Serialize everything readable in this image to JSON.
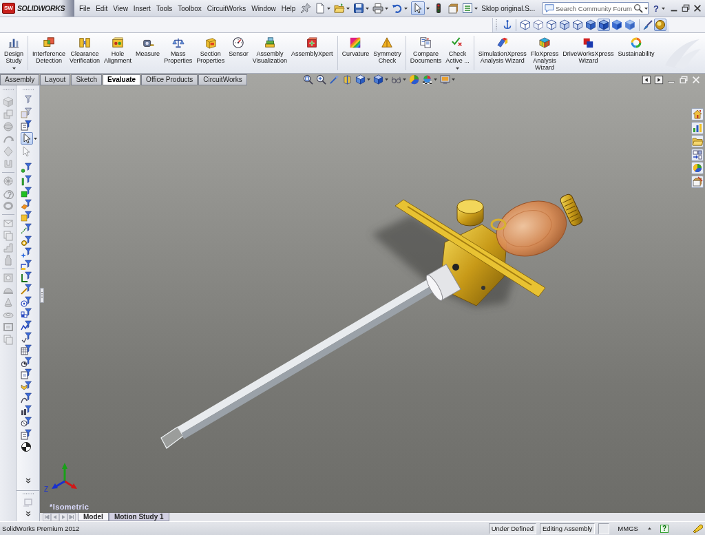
{
  "window": {
    "logo_mark": "SW",
    "logo": "SOLIDWORKS",
    "document_title": "Sklop original.S..."
  },
  "menu": [
    "File",
    "Edit",
    "View",
    "Insert",
    "Tools",
    "Toolbox",
    "CircuitWorks",
    "Window",
    "Help"
  ],
  "standard_toolbar": {
    "select_tool": {
      "selected": true
    }
  },
  "search": {
    "placeholder": "Search Community Forum"
  },
  "help_button": {
    "label": "?"
  },
  "view_toolbar": {
    "display_styles": [
      {
        "selected": false
      },
      {
        "selected": false
      },
      {
        "selected": false
      },
      {
        "selected": false
      },
      {
        "selected": false
      },
      {
        "selected": false
      },
      {
        "selected": true
      },
      {
        "selected": false
      },
      {
        "selected": false
      }
    ],
    "realview": {
      "on": true
    }
  },
  "ribbon": {
    "groups": [
      {
        "buttons": [
          {
            "label": "Design\nStudy",
            "dropdown": true
          }
        ]
      },
      {
        "buttons": [
          {
            "label": "Interference\nDetection",
            "dropdown": false
          },
          {
            "label": "Clearance\nVerification",
            "dropdown": false
          },
          {
            "label": "Hole\nAlignment",
            "dropdown": false
          },
          {
            "label": "Measure",
            "dropdown": false
          },
          {
            "label": "Mass\nProperties",
            "dropdown": false
          },
          {
            "label": "Section\nProperties",
            "dropdown": false
          },
          {
            "label": "Sensor",
            "dropdown": false
          },
          {
            "label": "Assembly\nVisualization",
            "dropdown": false
          },
          {
            "label": "AssemblyXpert",
            "dropdown": false
          }
        ]
      },
      {
        "buttons": [
          {
            "label": "Curvature",
            "dropdown": false
          },
          {
            "label": "Symmetry\nCheck",
            "dropdown": false
          }
        ]
      },
      {
        "buttons": [
          {
            "label": "Compare\nDocuments",
            "dropdown": false
          },
          {
            "label": "Check\nActive ...",
            "dropdown": true
          }
        ]
      },
      {
        "buttons": [
          {
            "label": "SimulationXpress\nAnalysis Wizard",
            "dropdown": false
          },
          {
            "label": "FloXpress\nAnalysis\nWizard",
            "dropdown": false
          },
          {
            "label": "DriveWorksXpress\nWizard",
            "dropdown": false
          },
          {
            "label": "Sustainability",
            "dropdown": false
          }
        ]
      }
    ]
  },
  "tabs": [
    {
      "label": "Assembly",
      "selected": false
    },
    {
      "label": "Layout",
      "selected": false
    },
    {
      "label": "Sketch",
      "selected": false
    },
    {
      "label": "Evaluate",
      "selected": true
    },
    {
      "label": "Office Products",
      "selected": false
    },
    {
      "label": "CircuitWorks",
      "selected": false
    }
  ],
  "feature_toolbar": {
    "disabled": true
  },
  "selection_filter": {
    "select_tool": {
      "selected": true
    }
  },
  "viewport": {
    "view_name": "*Isometric",
    "triad_axis_label": "Z"
  },
  "model_tabs": [
    {
      "label": "Model",
      "selected": true
    },
    {
      "label": "Motion Study 1",
      "selected": false
    }
  ],
  "status_bar": {
    "product": "SolidWorks Premium 2012",
    "fields": [
      "Under Defined",
      "Editing Assembly"
    ],
    "units": "MMGS",
    "help_glyph": "?"
  }
}
